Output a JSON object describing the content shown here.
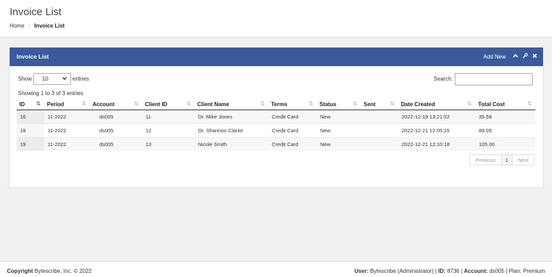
{
  "page": {
    "title": "Invoice List",
    "breadcrumb": [
      {
        "label": "Home"
      },
      {
        "label": "Invoice List"
      }
    ],
    "breadcrumb_sep": "/"
  },
  "panel": {
    "title": "Invoice List",
    "add_new": "Add New",
    "icons": [
      "chevron-up-icon",
      "wrench-icon",
      "close-icon"
    ],
    "header_color": "#3a5a9c"
  },
  "controls": {
    "show_label": "Show",
    "length_value": "10",
    "entries_label": "entries",
    "search_label": "Search:",
    "search_value": ""
  },
  "info": "Showing 1 to 3 of 3 entries",
  "table": {
    "columns": [
      "ID",
      "Period",
      "Account",
      "Client ID",
      "Client Name",
      "Terms",
      "Status",
      "Sent",
      "Date Created",
      "Total Cost"
    ],
    "rows": [
      [
        "16",
        "11-2022",
        "ds005",
        "11",
        "Dr. Mike Jones",
        "Credit Card",
        "New",
        "",
        "2022-12-19 13:21:52",
        "35.58"
      ],
      [
        "18",
        "11-2022",
        "ds005",
        "12",
        "Dr. Shannon Clarke",
        "Credit Card",
        "New",
        "",
        "2022-12-21 12:05:25",
        "89.05"
      ],
      [
        "19",
        "11-2022",
        "ds005",
        "13",
        "Nicole Smith",
        "Credit Card",
        "New",
        "",
        "2022-12-21 12:10:18",
        "105.00"
      ]
    ]
  },
  "pagination": {
    "previous": "Previous",
    "current": "1",
    "next": "Next"
  },
  "footer": {
    "copyright_label": "Copyright",
    "copyright_text": "Bytescribe, Inc. © 2022",
    "user_label": "User:",
    "user_value": "Bytescribe (Administrator)",
    "id_label": "ID:",
    "id_value": "8736",
    "account_label": "Account:",
    "account_value": "ds005",
    "plan_text": "Plan: Premium",
    "sep": "|"
  }
}
